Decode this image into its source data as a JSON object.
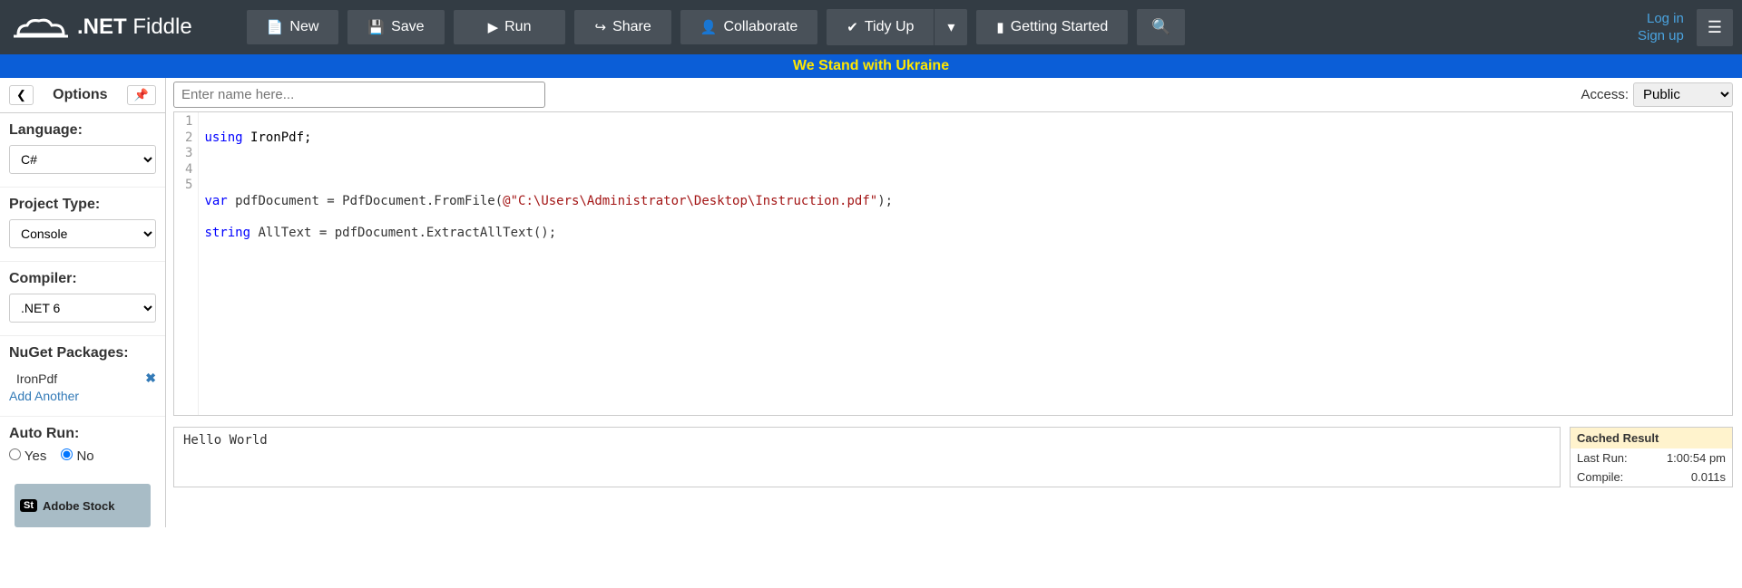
{
  "header": {
    "logo_bold": ".NET",
    "logo_light": " Fiddle",
    "buttons": {
      "new": "New",
      "save": "Save",
      "run": "Run",
      "share": "Share",
      "collaborate": "Collaborate",
      "tidy": "Tidy Up",
      "getting_started": "Getting Started"
    },
    "auth": {
      "login": "Log in",
      "signup": "Sign up"
    }
  },
  "banner": "We Stand with Ukraine",
  "sidebar": {
    "title": "Options",
    "groups": {
      "language": {
        "label": "Language:",
        "value": "C#"
      },
      "project_type": {
        "label": "Project Type:",
        "value": "Console"
      },
      "compiler": {
        "label": "Compiler:",
        "value": ".NET 6"
      },
      "nuget": {
        "label": "NuGet Packages:",
        "pkg": "IronPdf",
        "add": "Add Another"
      },
      "autorun": {
        "label": "Auto Run:",
        "yes": "Yes",
        "no": "No",
        "selected": "no"
      }
    },
    "ad": "Adobe Stock"
  },
  "content": {
    "name_placeholder": "Enter name here...",
    "access_label": "Access:",
    "access_value": "Public"
  },
  "editor": {
    "lines": [
      "1",
      "2",
      "3",
      "4",
      "5"
    ]
  },
  "code": {
    "l1_kw": "using",
    "l1_rest": " IronPdf;",
    "l3_kw": "var",
    "l3_a": " pdfDocument = PdfDocument.FromFile(",
    "l3_str": "@\"C:\\Users\\Administrator\\Desktop\\Instruction.pdf\"",
    "l3_b": ");",
    "l4_kw": "string",
    "l4_rest": " AllText = pdfDocument.ExtractAllText();"
  },
  "output": {
    "text": "Hello World"
  },
  "stats": {
    "header": "Cached Result",
    "rows": [
      {
        "k": "Last Run:",
        "v": "1:00:54 pm"
      },
      {
        "k": "Compile:",
        "v": "0.011s"
      }
    ]
  }
}
